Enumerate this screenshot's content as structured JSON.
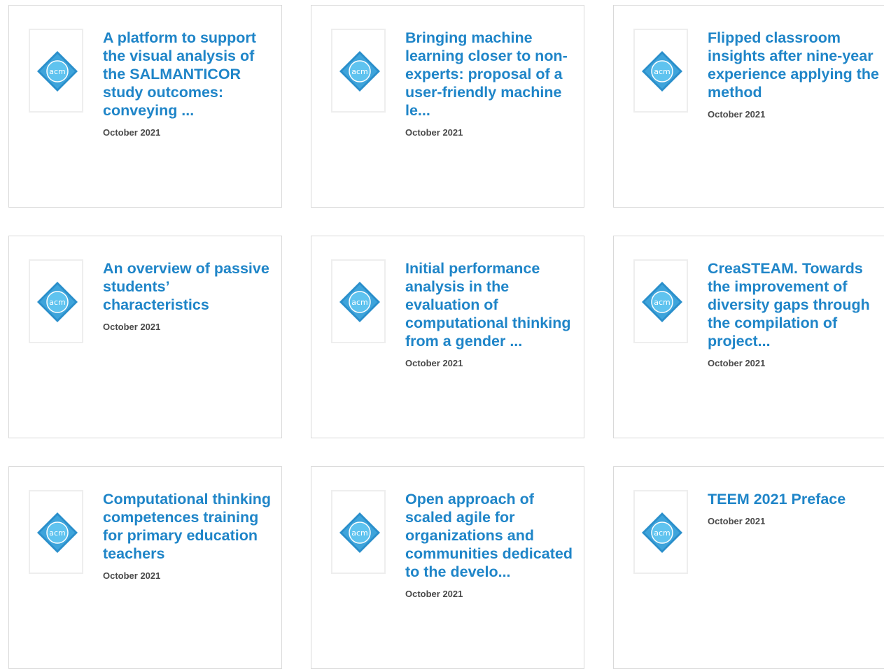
{
  "cards": [
    {
      "title": "A platform to support the visual analysis of the SALMANTICOR study outcomes: conveying ...",
      "date": "October 2021",
      "logo_text": "acm"
    },
    {
      "title": "Bringing machine learning closer to non-experts: proposal of a user-friendly machine le...",
      "date": "October 2021",
      "logo_text": "acm"
    },
    {
      "title": "Flipped classroom insights after nine-year experience applying the method",
      "date": "October 2021",
      "logo_text": "acm"
    },
    {
      "title": "An overview of passive students’ characteristics",
      "date": "October 2021",
      "logo_text": "acm"
    },
    {
      "title": "Initial performance analysis in the evaluation of computational thinking from a gender ...",
      "date": "October 2021",
      "logo_text": "acm"
    },
    {
      "title": "CreaSTEAM. Towards the improvement of diversity gaps through the compilation of project...",
      "date": "October 2021",
      "logo_text": "acm"
    },
    {
      "title": "Computational thinking competences training for primary education teachers",
      "date": "October 2021",
      "logo_text": "acm"
    },
    {
      "title": "Open approach of scaled agile for organizations and communities dedicated to the develo...",
      "date": "October 2021",
      "logo_text": "acm"
    },
    {
      "title": "TEEM 2021 Preface",
      "date": "October 2021",
      "logo_text": "acm"
    }
  ],
  "colors": {
    "title": "#1f85c8",
    "date": "#4a4a4a",
    "logo_dark": "#2a8fcb",
    "logo_light": "#5fc3ef"
  },
  "icons": {
    "thumbnail": "acm-logo-icon"
  }
}
